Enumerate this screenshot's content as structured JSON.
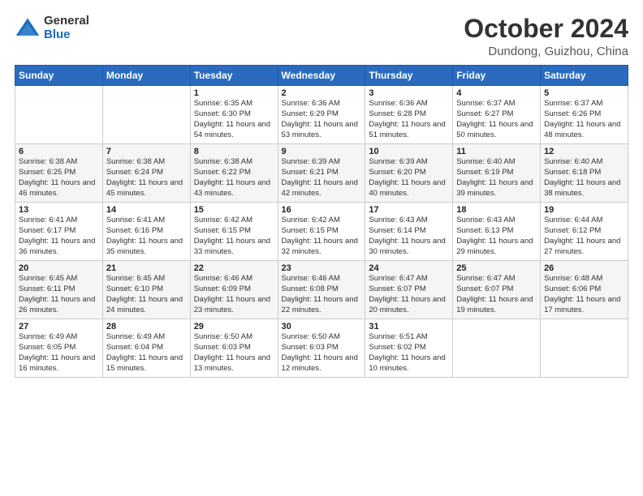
{
  "logo": {
    "general": "General",
    "blue": "Blue"
  },
  "title": "October 2024",
  "location": "Dundong, Guizhou, China",
  "days_of_week": [
    "Sunday",
    "Monday",
    "Tuesday",
    "Wednesday",
    "Thursday",
    "Friday",
    "Saturday"
  ],
  "weeks": [
    [
      {
        "day": "",
        "info": ""
      },
      {
        "day": "",
        "info": ""
      },
      {
        "day": "1",
        "info": "Sunrise: 6:35 AM\nSunset: 6:30 PM\nDaylight: 11 hours and 54 minutes."
      },
      {
        "day": "2",
        "info": "Sunrise: 6:36 AM\nSunset: 6:29 PM\nDaylight: 11 hours and 53 minutes."
      },
      {
        "day": "3",
        "info": "Sunrise: 6:36 AM\nSunset: 6:28 PM\nDaylight: 11 hours and 51 minutes."
      },
      {
        "day": "4",
        "info": "Sunrise: 6:37 AM\nSunset: 6:27 PM\nDaylight: 11 hours and 50 minutes."
      },
      {
        "day": "5",
        "info": "Sunrise: 6:37 AM\nSunset: 6:26 PM\nDaylight: 11 hours and 48 minutes."
      }
    ],
    [
      {
        "day": "6",
        "info": "Sunrise: 6:38 AM\nSunset: 6:25 PM\nDaylight: 11 hours and 46 minutes."
      },
      {
        "day": "7",
        "info": "Sunrise: 6:38 AM\nSunset: 6:24 PM\nDaylight: 11 hours and 45 minutes."
      },
      {
        "day": "8",
        "info": "Sunrise: 6:38 AM\nSunset: 6:22 PM\nDaylight: 11 hours and 43 minutes."
      },
      {
        "day": "9",
        "info": "Sunrise: 6:39 AM\nSunset: 6:21 PM\nDaylight: 11 hours and 42 minutes."
      },
      {
        "day": "10",
        "info": "Sunrise: 6:39 AM\nSunset: 6:20 PM\nDaylight: 11 hours and 40 minutes."
      },
      {
        "day": "11",
        "info": "Sunrise: 6:40 AM\nSunset: 6:19 PM\nDaylight: 11 hours and 39 minutes."
      },
      {
        "day": "12",
        "info": "Sunrise: 6:40 AM\nSunset: 6:18 PM\nDaylight: 11 hours and 38 minutes."
      }
    ],
    [
      {
        "day": "13",
        "info": "Sunrise: 6:41 AM\nSunset: 6:17 PM\nDaylight: 11 hours and 36 minutes."
      },
      {
        "day": "14",
        "info": "Sunrise: 6:41 AM\nSunset: 6:16 PM\nDaylight: 11 hours and 35 minutes."
      },
      {
        "day": "15",
        "info": "Sunrise: 6:42 AM\nSunset: 6:15 PM\nDaylight: 11 hours and 33 minutes."
      },
      {
        "day": "16",
        "info": "Sunrise: 6:42 AM\nSunset: 6:15 PM\nDaylight: 11 hours and 32 minutes."
      },
      {
        "day": "17",
        "info": "Sunrise: 6:43 AM\nSunset: 6:14 PM\nDaylight: 11 hours and 30 minutes."
      },
      {
        "day": "18",
        "info": "Sunrise: 6:43 AM\nSunset: 6:13 PM\nDaylight: 11 hours and 29 minutes."
      },
      {
        "day": "19",
        "info": "Sunrise: 6:44 AM\nSunset: 6:12 PM\nDaylight: 11 hours and 27 minutes."
      }
    ],
    [
      {
        "day": "20",
        "info": "Sunrise: 6:45 AM\nSunset: 6:11 PM\nDaylight: 11 hours and 26 minutes."
      },
      {
        "day": "21",
        "info": "Sunrise: 6:45 AM\nSunset: 6:10 PM\nDaylight: 11 hours and 24 minutes."
      },
      {
        "day": "22",
        "info": "Sunrise: 6:46 AM\nSunset: 6:09 PM\nDaylight: 11 hours and 23 minutes."
      },
      {
        "day": "23",
        "info": "Sunrise: 6:46 AM\nSunset: 6:08 PM\nDaylight: 11 hours and 22 minutes."
      },
      {
        "day": "24",
        "info": "Sunrise: 6:47 AM\nSunset: 6:07 PM\nDaylight: 11 hours and 20 minutes."
      },
      {
        "day": "25",
        "info": "Sunrise: 6:47 AM\nSunset: 6:07 PM\nDaylight: 11 hours and 19 minutes."
      },
      {
        "day": "26",
        "info": "Sunrise: 6:48 AM\nSunset: 6:06 PM\nDaylight: 11 hours and 17 minutes."
      }
    ],
    [
      {
        "day": "27",
        "info": "Sunrise: 6:49 AM\nSunset: 6:05 PM\nDaylight: 11 hours and 16 minutes."
      },
      {
        "day": "28",
        "info": "Sunrise: 6:49 AM\nSunset: 6:04 PM\nDaylight: 11 hours and 15 minutes."
      },
      {
        "day": "29",
        "info": "Sunrise: 6:50 AM\nSunset: 6:03 PM\nDaylight: 11 hours and 13 minutes."
      },
      {
        "day": "30",
        "info": "Sunrise: 6:50 AM\nSunset: 6:03 PM\nDaylight: 11 hours and 12 minutes."
      },
      {
        "day": "31",
        "info": "Sunrise: 6:51 AM\nSunset: 6:02 PM\nDaylight: 11 hours and 10 minutes."
      },
      {
        "day": "",
        "info": ""
      },
      {
        "day": "",
        "info": ""
      }
    ]
  ]
}
